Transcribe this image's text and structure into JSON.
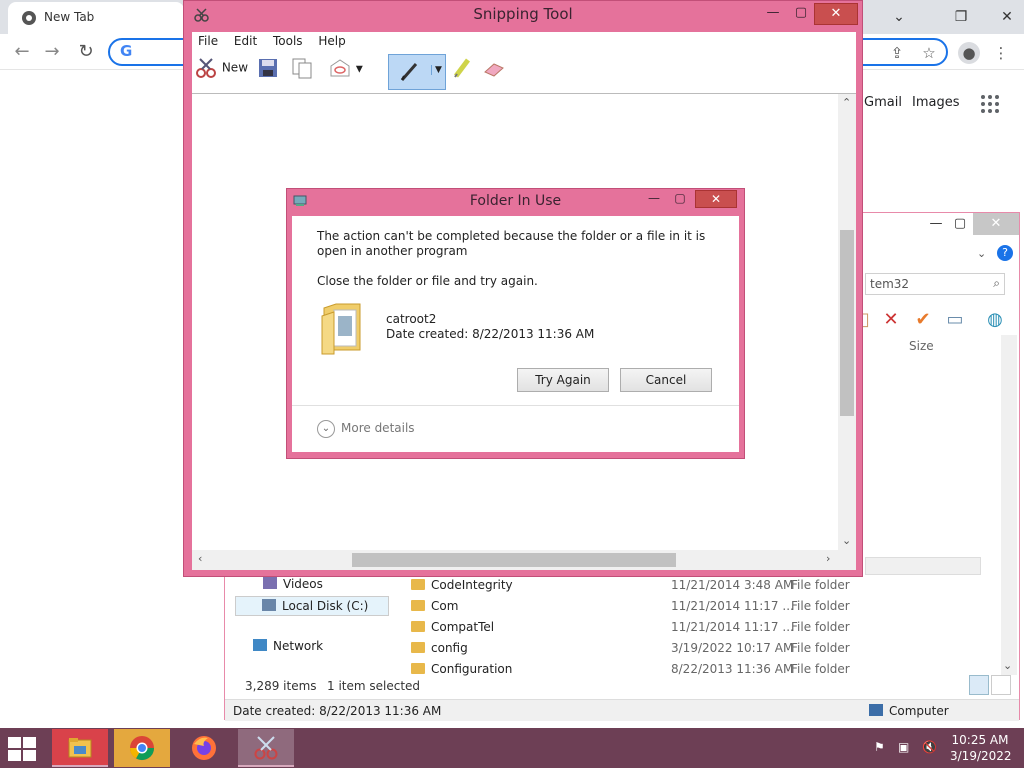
{
  "chrome": {
    "tab_title": "New Tab",
    "links": {
      "gmail": "Gmail",
      "images": "Images"
    }
  },
  "explorer": {
    "search_placeholder": "tem32",
    "size_header": "Size",
    "nav_items": [
      {
        "label": "Videos"
      },
      {
        "label": "Local Disk (C:)"
      },
      {
        "label": "Network"
      }
    ],
    "rows": [
      {
        "name": "CodeIntegrity",
        "date": "11/21/2014 3:48 AM",
        "type": "File folder"
      },
      {
        "name": "Com",
        "date": "11/21/2014 11:17 ...",
        "type": "File folder"
      },
      {
        "name": "CompatTel",
        "date": "11/21/2014 11:17 ...",
        "type": "File folder"
      },
      {
        "name": "config",
        "date": "3/19/2022 10:17 AM",
        "type": "File folder"
      },
      {
        "name": "Configuration",
        "date": "8/22/2013 11:36 AM",
        "type": "File folder"
      }
    ],
    "status_count": "3,289 items",
    "status_selected": "1 item selected",
    "detail_date": "Date created: 8/22/2013 11:36 AM",
    "detail_computer": "Computer"
  },
  "snipping_tool": {
    "title": "Snipping Tool",
    "menu": [
      "File",
      "Edit",
      "Tools",
      "Help"
    ],
    "new_label": "New"
  },
  "dialog": {
    "title": "Folder In Use",
    "message": "The action can't be completed because the folder or a file in it is open in another program",
    "instruction": "Close the folder or file and try again.",
    "item_name": "catroot2",
    "item_date": "Date created: 8/22/2013 11:36 AM",
    "try_again": "Try Again",
    "cancel": "Cancel",
    "more_details": "More details"
  },
  "taskbar": {
    "time": "10:25 AM",
    "date": "3/19/2022"
  },
  "colors": {
    "window_frame": "#e5729b",
    "taskbar": "#6d3f55",
    "chrome_accent": "#1a73e8"
  }
}
